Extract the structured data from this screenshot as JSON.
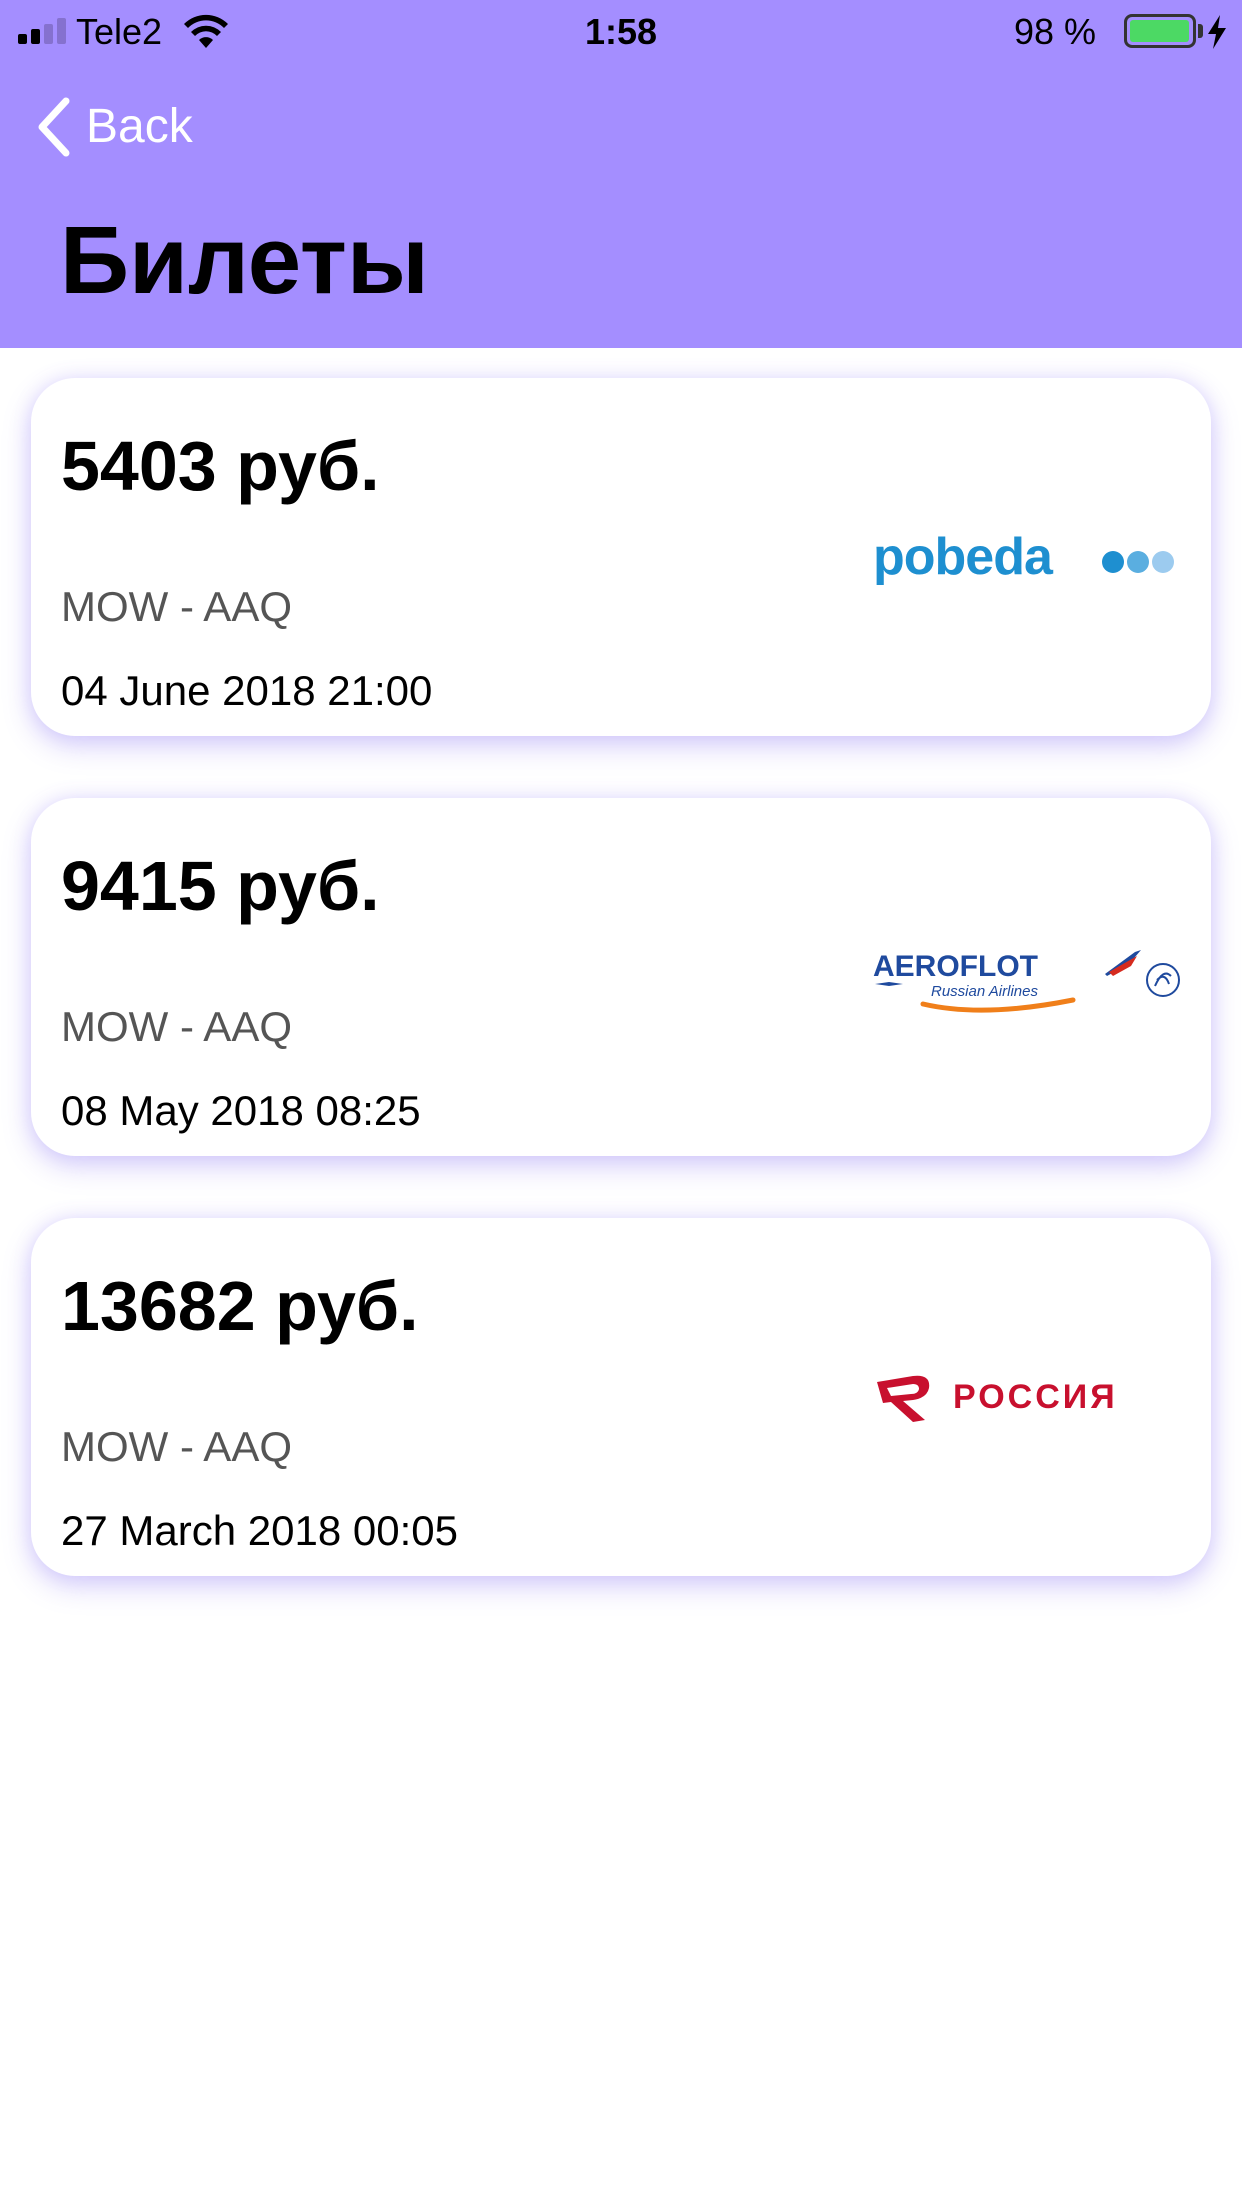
{
  "status_bar": {
    "carrier": "Tele2",
    "time": "1:58",
    "battery_percent": "98 %",
    "battery_level": 0.98,
    "battery_color": "#4cd964"
  },
  "nav": {
    "back_label": "Back",
    "title": "Билеты",
    "header_color": "#a48eff"
  },
  "tickets": [
    {
      "price": "5403 руб.",
      "route": "MOW - AAQ",
      "date": "04 June 2018 21:00",
      "airline_logo": "pobeda",
      "logo_text": "pobeda"
    },
    {
      "price": "9415 руб.",
      "route": "MOW - AAQ",
      "date": "08 May 2018 08:25",
      "airline_logo": "aeroflot",
      "logo_text": "AEROFLOT",
      "logo_subtext": "Russian Airlines"
    },
    {
      "price": "13682 руб.",
      "route": "MOW - AAQ",
      "date": "27 March 2018 00:05",
      "airline_logo": "rossiya",
      "logo_text": "РОССИЯ"
    }
  ]
}
